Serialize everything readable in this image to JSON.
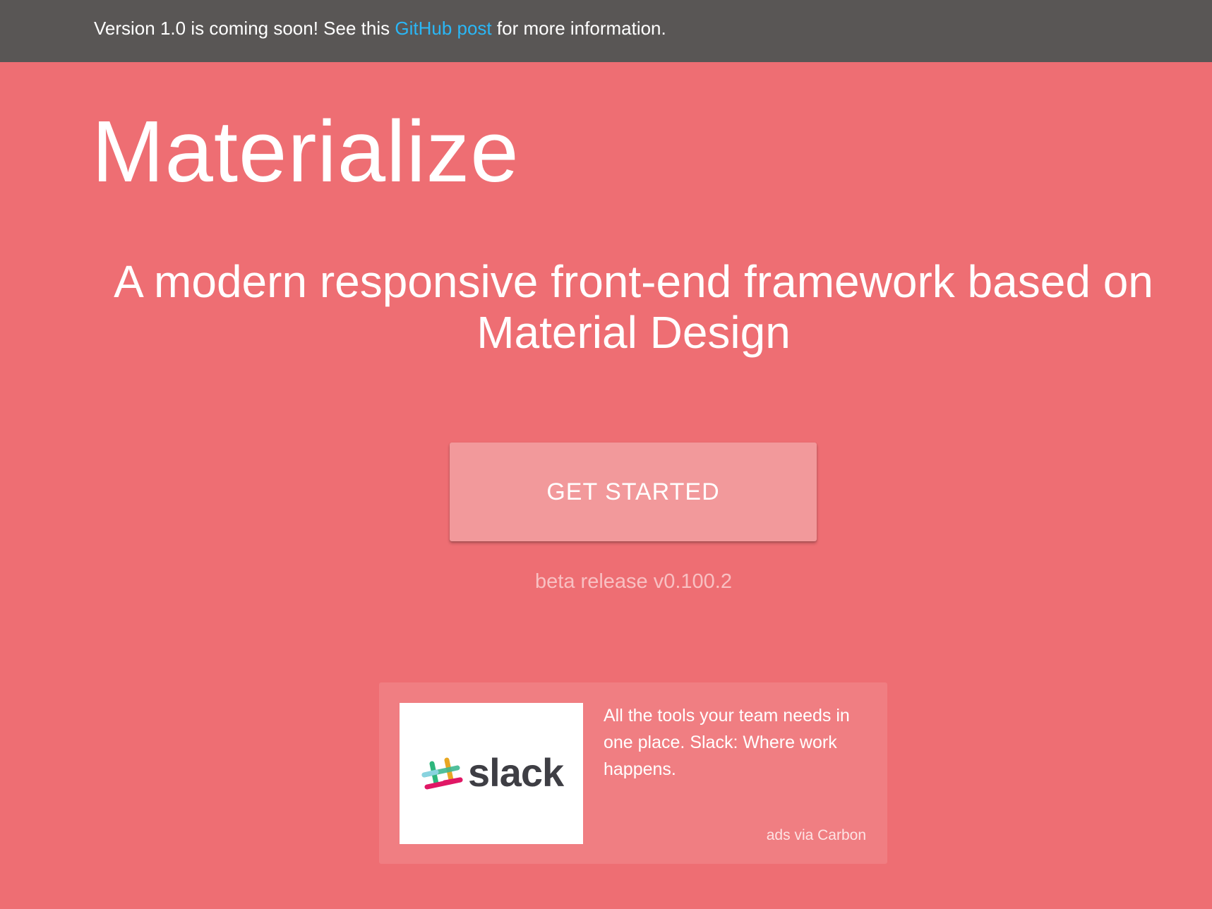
{
  "banner": {
    "text_before": "Version 1.0 is coming soon! See this ",
    "link_label": "GitHub post",
    "text_after": " for more information."
  },
  "hero": {
    "title": "Materialize",
    "tagline": "A modern responsive front-end framework based on Material Design",
    "cta_label": "GET STARTED",
    "release": "beta release v0.100.2"
  },
  "ad": {
    "logo_text": "slack",
    "text": "All the tools your team needs in one place. Slack: Where work happens.",
    "credit": "ads via Carbon"
  },
  "colors": {
    "page_background": "#ee6e73",
    "banner_background": "#595655",
    "link": "#2ab7f6",
    "button": "#f2999b",
    "ad_background": "#f07e82"
  },
  "icons": {
    "logo": "slack-hash-icon"
  }
}
